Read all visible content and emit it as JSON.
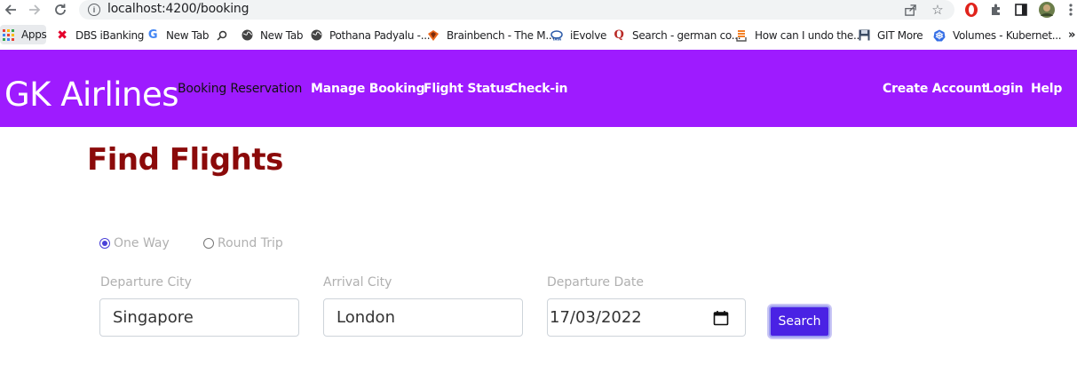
{
  "browser": {
    "url": "localhost:4200/booking",
    "bookmarks": [
      {
        "label": "Apps",
        "icon": "apps-grid-icon"
      },
      {
        "label": "DBS iBanking",
        "icon": "dbs-icon"
      },
      {
        "label": "New Tab",
        "icon": "google-icon"
      },
      {
        "label": "",
        "icon": "search-icon"
      },
      {
        "label": "New Tab",
        "icon": "globe-icon"
      },
      {
        "label": "Pothana Padyalu -...",
        "icon": "globe-icon"
      },
      {
        "label": "Brainbench - The M...",
        "icon": "brainbench-icon"
      },
      {
        "label": "iEvolve",
        "icon": "tata-icon"
      },
      {
        "label": "Search - german co...",
        "icon": "quora-icon"
      },
      {
        "label": "How can I undo the...",
        "icon": "stackoverflow-icon"
      },
      {
        "label": "GIT More",
        "icon": "floppy-icon"
      },
      {
        "label": "Volumes - Kubernet...",
        "icon": "kubernetes-icon"
      }
    ],
    "more_bookmarks": "»"
  },
  "header": {
    "brand": "GK Airlines",
    "nav": [
      "Booking Reservation",
      "Manage Booking",
      "Flight Status",
      "Check-in"
    ],
    "right_nav": [
      "Create Account",
      "Login",
      "Help"
    ]
  },
  "page": {
    "title": "Find Flights",
    "trip_types": [
      "One Way",
      "Round Trip"
    ],
    "selected_trip_type": "One Way",
    "departure_city_label": "Departure City",
    "departure_city": "Singapore",
    "arrival_city_label": "Arrival City",
    "arrival_city": "London",
    "departure_date_label": "Departure Date",
    "departure_date": "17/03/2022",
    "search_label": "Search"
  },
  "colors": {
    "header_bg": "#9e1bff",
    "title": "#8b0a0a",
    "button": "#4a22e4"
  }
}
